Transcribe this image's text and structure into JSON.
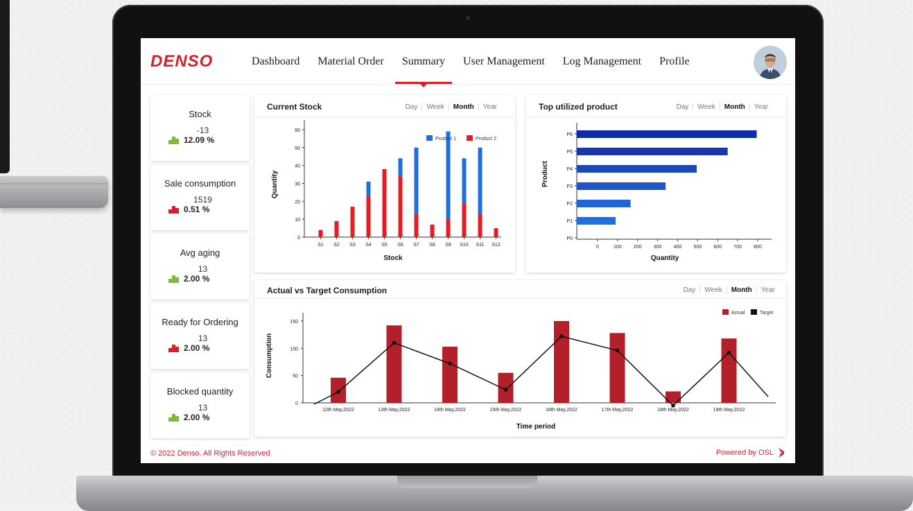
{
  "app": {
    "brand": "DENSO",
    "nav": [
      "Dashboard",
      "Material Order",
      "Summary",
      "User Management",
      "Log Management",
      "Profile"
    ],
    "active_nav": "Summary"
  },
  "stats": [
    {
      "title": "Stock",
      "value": "-13",
      "delta": "12.09 %",
      "trend": "up"
    },
    {
      "title": "Sale consumption",
      "value": "1519",
      "delta": "0.51 %",
      "trend": "down"
    },
    {
      "title": "Avg aging",
      "value": "13",
      "delta": "2.00 %",
      "trend": "up"
    },
    {
      "title": "Ready for Ordering",
      "value": "13",
      "delta": "2.00 %",
      "trend": "down"
    },
    {
      "title": "Blocked quantity",
      "value": "13",
      "delta": "2.00 %",
      "trend": "up"
    }
  ],
  "period_tabs": [
    "Day",
    "Week",
    "Month",
    "Year"
  ],
  "active_period": "Month",
  "colors": {
    "accent": "#dc1e2a",
    "product1": "#1f6fe0",
    "product2": "#e31e24",
    "actual": "#b3202a",
    "target": "#111111",
    "up": "#7dbb3a"
  },
  "footer": {
    "copyright": "© 2022 Denso. All Rights Reserved",
    "powered": "Powered by OSL"
  },
  "chart_data": [
    {
      "type": "bar",
      "stacked": true,
      "title": "Current Stock",
      "xlabel": "Stock",
      "ylabel": "Quantity",
      "categories": [
        "S1",
        "S2",
        "S3",
        "S4",
        "S5",
        "S6",
        "S7",
        "S8",
        "S9",
        "S10",
        "S11",
        "S12"
      ],
      "series": [
        {
          "name": "Product 1",
          "values": [
            0,
            0,
            0,
            8,
            0,
            10,
            37,
            0,
            49,
            25,
            37,
            0
          ]
        },
        {
          "name": "Product 2",
          "values": [
            4,
            9,
            17,
            23,
            38,
            34,
            13,
            7,
            10,
            19,
            13,
            5
          ]
        }
      ],
      "ylim": [
        0,
        60
      ],
      "yticks": [
        0,
        10,
        20,
        30,
        40,
        50,
        60
      ],
      "legend": "top-right"
    },
    {
      "type": "bar",
      "orientation": "horizontal",
      "title": "Top utilized product",
      "xlabel": "Quantity",
      "ylabel": "Product",
      "categories": [
        "P0",
        "P1",
        "P2",
        "P3",
        "P4",
        "P5",
        "P6"
      ],
      "values": [
        0,
        90,
        165,
        340,
        495,
        650,
        795
      ],
      "xlim": [
        0,
        800
      ],
      "xticks": [
        0,
        100,
        200,
        300,
        400,
        500,
        600,
        700,
        800
      ]
    },
    {
      "type": "bar",
      "title": "Actual vs Target Consumption",
      "xlabel": "Time period",
      "ylabel": "Consumption",
      "categories": [
        "12th May,2022",
        "13th May,2022",
        "14th May,2022",
        "15th May,2022",
        "16th May,2022",
        "17th May,2022",
        "18th May,2022",
        "19th May,2022"
      ],
      "series": [
        {
          "name": "Actual",
          "type": "bar",
          "values": [
            46,
            142,
            103,
            55,
            150,
            128,
            21,
            118
          ]
        },
        {
          "name": "Target",
          "type": "line",
          "values": [
            20,
            110,
            72,
            24,
            122,
            96,
            -5,
            92
          ]
        }
      ],
      "ylim": [
        0,
        150
      ],
      "yticks": [
        0,
        50,
        100,
        150
      ],
      "legend": "top-right"
    }
  ]
}
